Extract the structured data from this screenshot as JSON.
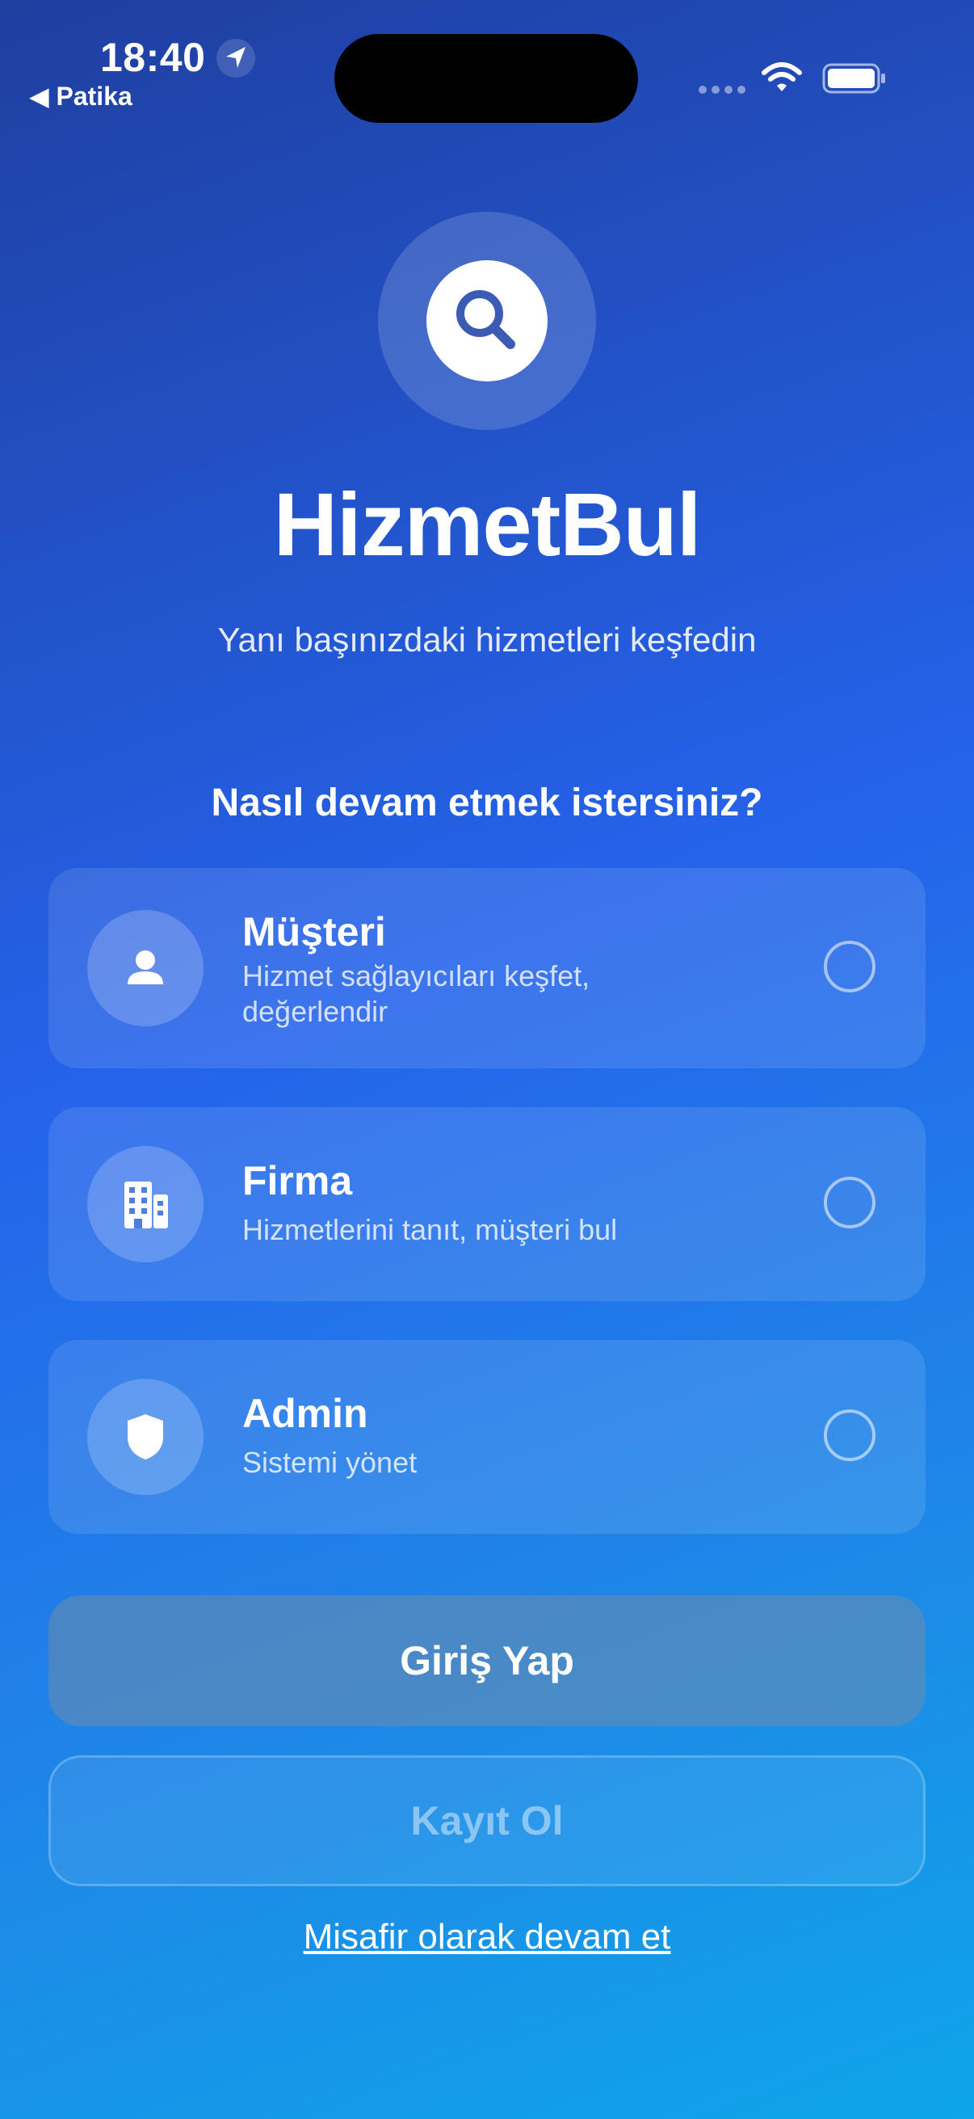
{
  "status_bar": {
    "time": "18:40",
    "back_label": "◀ Patika",
    "icons": [
      "location-arrow-icon",
      "cellular-icon",
      "wifi-icon",
      "battery-icon"
    ]
  },
  "hero": {
    "logo_icon": "search-icon",
    "app_title": "HizmetBul",
    "subtitle": "Yanı başınızdaki hizmetleri keşfedin"
  },
  "role_prompt": "Nasıl devam etmek istersiniz?",
  "roles": [
    {
      "title": "Müşteri",
      "description": "Hizmet sağlayıcıları keşfet, değerlendir",
      "icon": "person-icon",
      "selected": false
    },
    {
      "title": "Firma",
      "description": "Hizmetlerini tanıt, müşteri bul",
      "icon": "building-icon",
      "selected": false
    },
    {
      "title": "Admin",
      "description": "Sistemi yönet",
      "icon": "shield-icon",
      "selected": false
    }
  ],
  "actions": {
    "login_label": "Giriş Yap",
    "register_label": "Kayıt Ol",
    "guest_label": "Misafir olarak devam et"
  },
  "colors": {
    "gradient_top": "#1f3fa0",
    "gradient_mid": "#2563eb",
    "gradient_bottom": "#0ea5e9",
    "text": "#ffffff"
  }
}
